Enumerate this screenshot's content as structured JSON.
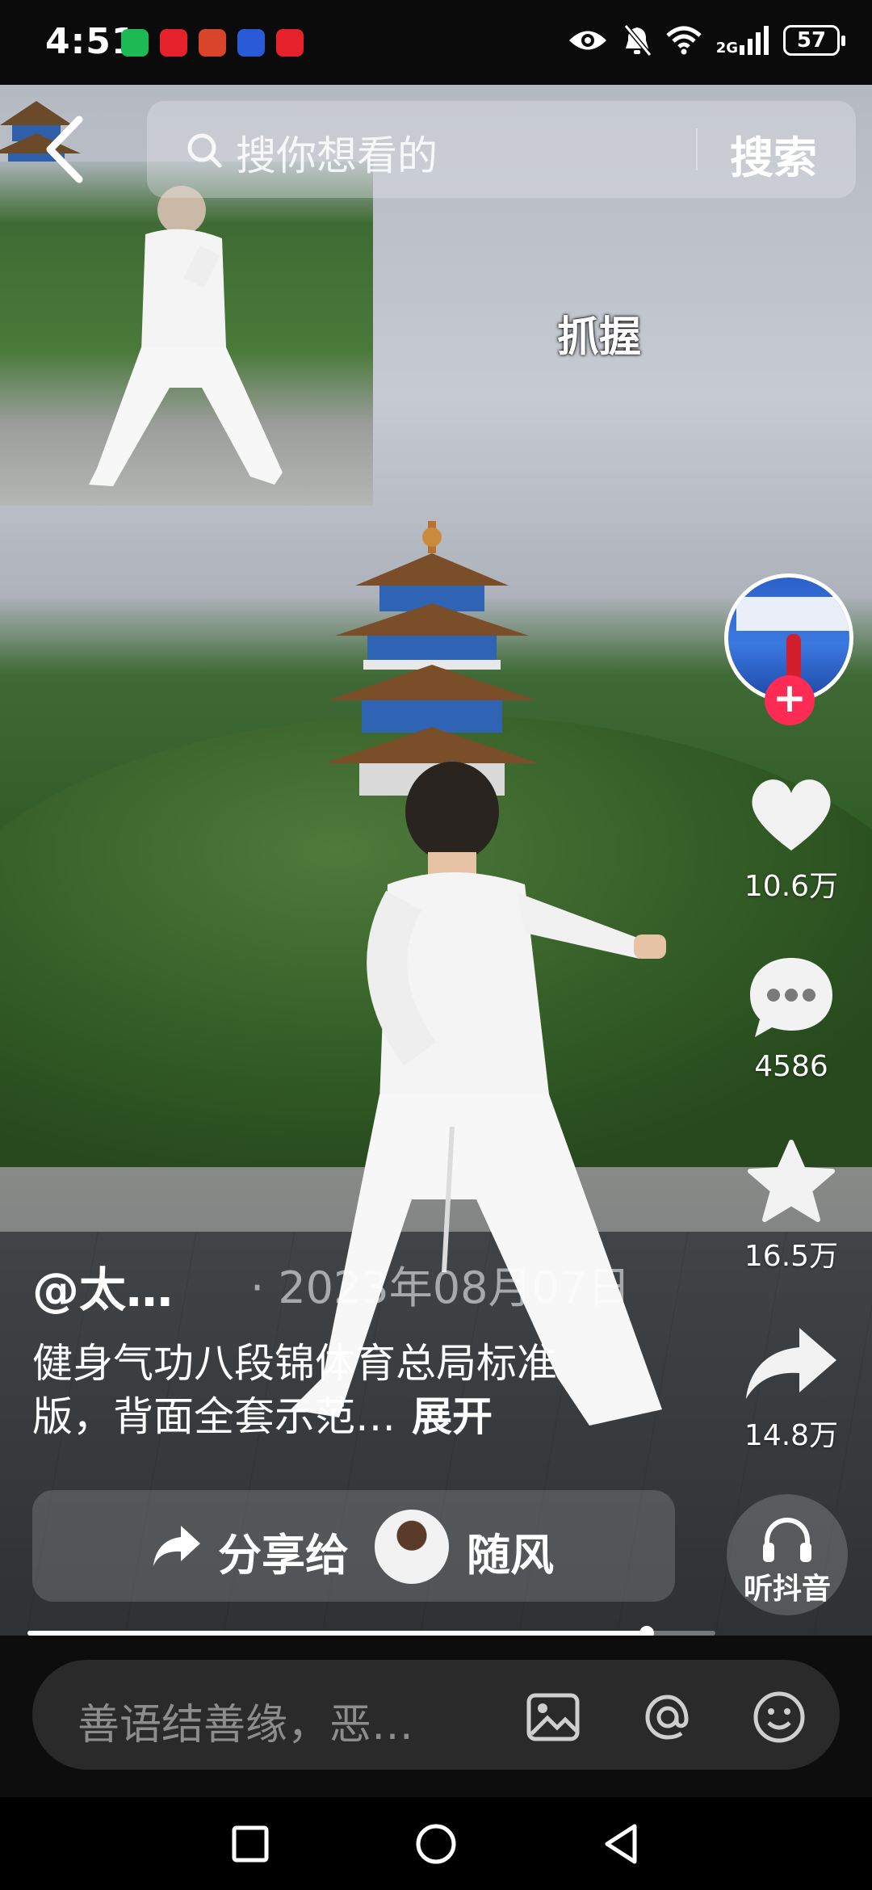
{
  "status_bar": {
    "time": "4:51",
    "battery": "57",
    "network_tag": "2G",
    "notification_icons": [
      "hourglass-app-icon",
      "red-app-icon",
      "game-app-icon",
      "bulb-app-icon",
      "red-app-icon"
    ]
  },
  "search": {
    "placeholder": "搜你想看的",
    "submit_label": "搜索"
  },
  "video": {
    "overlay_caption": "抓握"
  },
  "rail": {
    "like_count": "10.6万",
    "comment_count": "4586",
    "favorite_count": "16.5万",
    "share_count": "14.8万"
  },
  "post": {
    "author": "@太…",
    "date": "· 2023年08月07日",
    "description": "健身气功八段锦体育总局标准版，背面全套示范…",
    "expand_label": "展开"
  },
  "share_bar": {
    "label": "分享给",
    "recipient": "随风"
  },
  "listen": {
    "label": "听抖音"
  },
  "progress": {
    "fraction": 0.9
  },
  "comment": {
    "placeholder": "善语结善缘，恶…"
  },
  "colors": {
    "follow_accent": "#fe2c55",
    "background": "#000000"
  }
}
